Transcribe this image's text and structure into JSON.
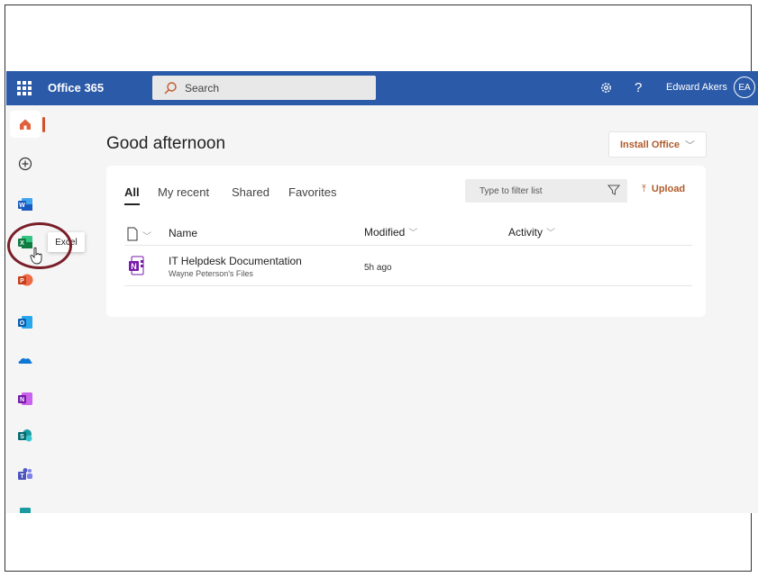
{
  "topbar": {
    "brand": "Office 365",
    "search_placeholder": "Search",
    "settings_icon": "gear-icon",
    "help_label": "?",
    "user_name": "Edward Akers",
    "avatar_initials": "EA",
    "bar_color": "#2b5aa8"
  },
  "rail": {
    "items": [
      {
        "name": "home",
        "icon": "home-icon",
        "active": true
      },
      {
        "name": "create",
        "icon": "plus-circle-icon"
      },
      {
        "name": "word",
        "icon": "word-icon"
      },
      {
        "name": "excel",
        "icon": "excel-icon"
      },
      {
        "name": "powerpoint",
        "icon": "powerpoint-icon"
      },
      {
        "name": "outlook",
        "icon": "outlook-icon"
      },
      {
        "name": "onedrive",
        "icon": "onedrive-icon"
      },
      {
        "name": "onenote",
        "icon": "onenote-icon"
      },
      {
        "name": "sharepoint",
        "icon": "sharepoint-icon"
      },
      {
        "name": "teams",
        "icon": "teams-icon"
      }
    ],
    "tooltip": "Excel"
  },
  "main": {
    "greeting": "Good afternoon",
    "install_label": "Install Office",
    "tabs": [
      "All",
      "My recent",
      "Shared",
      "Favorites"
    ],
    "filter_placeholder": "Type to filter list",
    "upload_label": "Upload",
    "columns": {
      "name": "Name",
      "modified": "Modified",
      "activity": "Activity"
    },
    "files": [
      {
        "name": "IT Helpdesk Documentation",
        "location": "Wayne Peterson's Files",
        "modified": "5h ago",
        "icon": "onenote-icon"
      }
    ]
  },
  "colors": {
    "accent": "#b05a2a",
    "highlight_circle": "#7a1f2a"
  }
}
